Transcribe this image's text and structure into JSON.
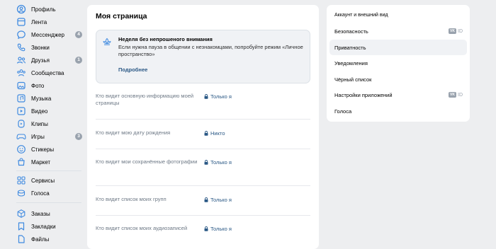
{
  "sidebar": {
    "items": [
      {
        "label": "Профиль",
        "icon": "profile-icon"
      },
      {
        "label": "Лента",
        "icon": "news-icon"
      },
      {
        "label": "Мессенджер",
        "icon": "message-icon",
        "badge": "4"
      },
      {
        "label": "Звонки",
        "icon": "phone-icon"
      },
      {
        "label": "Друзья",
        "icon": "friends-icon",
        "badge": "1"
      },
      {
        "label": "Сообщества",
        "icon": "communities-icon"
      },
      {
        "label": "Фото",
        "icon": "photo-icon"
      },
      {
        "label": "Музыка",
        "icon": "music-icon"
      },
      {
        "label": "Видео",
        "icon": "video-icon"
      },
      {
        "label": "Клипы",
        "icon": "clips-icon"
      },
      {
        "label": "Игры",
        "icon": "games-icon",
        "badge": "3"
      },
      {
        "label": "Стикеры",
        "icon": "stickers-icon"
      },
      {
        "label": "Маркет",
        "icon": "market-icon"
      },
      {
        "label": "Сервисы",
        "icon": "services-icon"
      },
      {
        "label": "Голоса",
        "icon": "votes-icon"
      },
      {
        "label": "Заказы",
        "icon": "orders-icon"
      },
      {
        "label": "Закладки",
        "icon": "bookmarks-icon"
      },
      {
        "label": "Файлы",
        "icon": "files-icon"
      }
    ]
  },
  "main": {
    "title": "Моя страница",
    "notice": {
      "title": "Неделя без непрошеного внимания",
      "text": "Если нужна пауза в общении с незнакомцами, попробуйте режим «Личное пространство»",
      "link": "Подробнее",
      "icon": "lotus-icon"
    },
    "settings": [
      {
        "label": "Кто видит основную информацию моей страницы",
        "value": "Только я"
      },
      {
        "label": "Кто видит мою дату рождения",
        "value": "Никто"
      },
      {
        "label": "Кто видит мои сохранённые фотографии",
        "value": "Только я"
      },
      {
        "label": "Кто видит список моих групп",
        "value": "Только я"
      },
      {
        "label": "Кто видит список моих аудиозаписей",
        "value": "Только я"
      }
    ]
  },
  "right_menu": {
    "header": "Аккаунт и внешний вид",
    "items": [
      {
        "label": "Безопасность",
        "badge": "VK",
        "badge_text": "ID"
      },
      {
        "label": "Приватность",
        "active": true
      },
      {
        "label": "Уведомления"
      },
      {
        "label": "Чёрный список"
      },
      {
        "label": "Настройки приложений",
        "badge": "VK",
        "badge_text": "ID"
      },
      {
        "label": "Голоса"
      }
    ]
  },
  "colors": {
    "accent": "#2a5885",
    "icon": "#3f8ae0",
    "badge": "#99a2ad",
    "background": "#edeef0"
  }
}
